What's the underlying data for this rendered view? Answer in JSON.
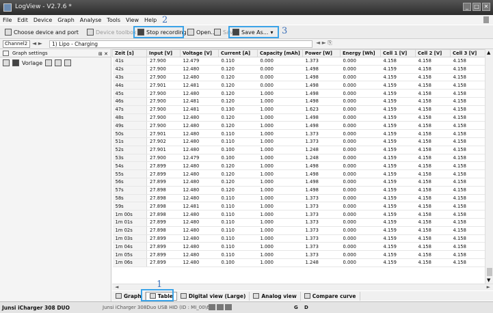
{
  "window": {
    "title": "LogView - V2.7.6 *"
  },
  "menu": [
    "File",
    "Edit",
    "Device",
    "Graph",
    "Analyse",
    "Tools",
    "View",
    "Help"
  ],
  "toolbar": {
    "choose_device": "Choose device and port",
    "device_toolbox": "Device toolbox",
    "stop_recording": "Stop recording",
    "open": "Open...",
    "save": "Save",
    "save_as": "Save As..."
  },
  "annotations": {
    "a1": "1",
    "a2": "2",
    "a3": "3"
  },
  "channel": {
    "selected": "Channel2",
    "device_field": "1) Lipo - Charging"
  },
  "left_panel": {
    "header": "Graph settings",
    "vorlage": "Vorlage"
  },
  "table": {
    "columns": [
      "Zeit [s]",
      "Input [V]",
      "Voltage [V]",
      "Current [A]",
      "Capacity [mAh]",
      "Power [W]",
      "Energy [Wh]",
      "Cell 1 [V]",
      "Cell 2 [V]",
      "Cell 3 [V]"
    ],
    "rows": [
      [
        "41s",
        "27.900",
        "12.479",
        "0.110",
        "0.000",
        "1.373",
        "0.000",
        "4.158",
        "4.158",
        "4.158"
      ],
      [
        "42s",
        "27.900",
        "12.480",
        "0.120",
        "0.000",
        "1.498",
        "0.000",
        "4.159",
        "4.158",
        "4.158"
      ],
      [
        "43s",
        "27.900",
        "12.480",
        "0.120",
        "0.000",
        "1.498",
        "0.000",
        "4.159",
        "4.158",
        "4.158"
      ],
      [
        "44s",
        "27.901",
        "12.481",
        "0.120",
        "0.000",
        "1.498",
        "0.000",
        "4.159",
        "4.158",
        "4.158"
      ],
      [
        "45s",
        "27.900",
        "12.480",
        "0.120",
        "1.000",
        "1.498",
        "0.000",
        "4.159",
        "4.158",
        "4.158"
      ],
      [
        "46s",
        "27.900",
        "12.481",
        "0.120",
        "1.000",
        "1.498",
        "0.000",
        "4.159",
        "4.158",
        "4.158"
      ],
      [
        "47s",
        "27.900",
        "12.481",
        "0.130",
        "1.000",
        "1.623",
        "0.000",
        "4.159",
        "4.158",
        "4.158"
      ],
      [
        "48s",
        "27.900",
        "12.480",
        "0.120",
        "1.000",
        "1.498",
        "0.000",
        "4.159",
        "4.158",
        "4.158"
      ],
      [
        "49s",
        "27.900",
        "12.480",
        "0.120",
        "1.000",
        "1.498",
        "0.000",
        "4.159",
        "4.158",
        "4.158"
      ],
      [
        "50s",
        "27.901",
        "12.480",
        "0.110",
        "1.000",
        "1.373",
        "0.000",
        "4.159",
        "4.158",
        "4.158"
      ],
      [
        "51s",
        "27.902",
        "12.480",
        "0.110",
        "1.000",
        "1.373",
        "0.000",
        "4.159",
        "4.158",
        "4.158"
      ],
      [
        "52s",
        "27.901",
        "12.480",
        "0.100",
        "1.000",
        "1.248",
        "0.000",
        "4.159",
        "4.158",
        "4.158"
      ],
      [
        "53s",
        "27.900",
        "12.479",
        "0.100",
        "1.000",
        "1.248",
        "0.000",
        "4.159",
        "4.158",
        "4.158"
      ],
      [
        "54s",
        "27.899",
        "12.480",
        "0.120",
        "1.000",
        "1.498",
        "0.000",
        "4.159",
        "4.158",
        "4.158"
      ],
      [
        "55s",
        "27.899",
        "12.480",
        "0.120",
        "1.000",
        "1.498",
        "0.000",
        "4.159",
        "4.158",
        "4.158"
      ],
      [
        "56s",
        "27.899",
        "12.480",
        "0.120",
        "1.000",
        "1.498",
        "0.000",
        "4.159",
        "4.158",
        "4.158"
      ],
      [
        "57s",
        "27.898",
        "12.480",
        "0.120",
        "1.000",
        "1.498",
        "0.000",
        "4.159",
        "4.158",
        "4.158"
      ],
      [
        "58s",
        "27.898",
        "12.480",
        "0.110",
        "1.000",
        "1.373",
        "0.000",
        "4.159",
        "4.158",
        "4.158"
      ],
      [
        "59s",
        "27.898",
        "12.481",
        "0.110",
        "1.000",
        "1.373",
        "0.000",
        "4.159",
        "4.158",
        "4.158"
      ],
      [
        "1m 00s",
        "27.898",
        "12.480",
        "0.110",
        "1.000",
        "1.373",
        "0.000",
        "4.159",
        "4.158",
        "4.158"
      ],
      [
        "1m 01s",
        "27.899",
        "12.480",
        "0.110",
        "1.000",
        "1.373",
        "0.000",
        "4.159",
        "4.158",
        "4.158"
      ],
      [
        "1m 02s",
        "27.898",
        "12.480",
        "0.110",
        "1.000",
        "1.373",
        "0.000",
        "4.159",
        "4.158",
        "4.158"
      ],
      [
        "1m 03s",
        "27.899",
        "12.480",
        "0.110",
        "1.000",
        "1.373",
        "0.000",
        "4.159",
        "4.158",
        "4.158"
      ],
      [
        "1m 04s",
        "27.899",
        "12.480",
        "0.110",
        "1.000",
        "1.373",
        "0.000",
        "4.159",
        "4.158",
        "4.158"
      ],
      [
        "1m 05s",
        "27.899",
        "12.480",
        "0.110",
        "1.000",
        "1.373",
        "0.000",
        "4.159",
        "4.158",
        "4.158"
      ],
      [
        "1m 06s",
        "27.899",
        "12.480",
        "0.100",
        "1.000",
        "1.248",
        "0.000",
        "4.159",
        "4.158",
        "4.158"
      ]
    ]
  },
  "tabs": [
    "Graph",
    "Table",
    "Digital view (Large)",
    "Analog view",
    "Compare curve"
  ],
  "tabs_active_index": 1,
  "status": {
    "device": "Junsi iCharger 308 DUO",
    "usb": "Junsi iCharger 308Duo USB HID (ID : MI_00\\6)",
    "g": "G",
    "d": "D"
  },
  "colors": {
    "highlight": "#3aa3e8",
    "annotation": "#3a6fb8",
    "titlebar": "#2c2c2c"
  }
}
